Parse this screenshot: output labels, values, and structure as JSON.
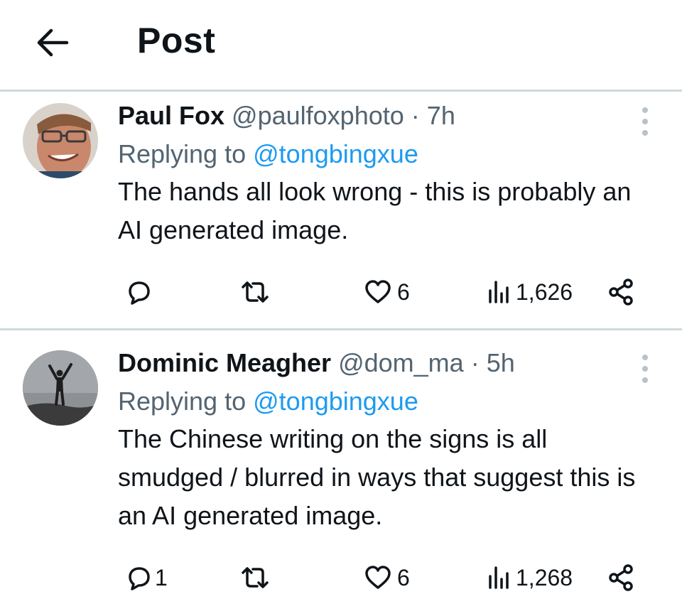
{
  "header": {
    "title": "Post",
    "back_icon": "arrow-left-icon"
  },
  "colors": {
    "link": "#1d9bf0",
    "secondary": "#536471",
    "primary": "#0f1419",
    "divider": "#cfd9de"
  },
  "replies": [
    {
      "name": "Paul Fox",
      "handle": "@paulfoxphoto",
      "separator": "·",
      "time": "7h",
      "replying_label": "Replying to",
      "replying_to": "@tongbingxue",
      "text": "The hands all look wrong - this is probably an AI generated image.",
      "reply_count": "",
      "likes": "6",
      "views": "1,626"
    },
    {
      "name": "Dominic Meagher",
      "handle": "@dom_ma",
      "separator": "·",
      "time": "5h",
      "replying_label": "Replying to",
      "replying_to": "@tongbingxue",
      "text": "The Chinese writing on the signs is all smudged / blurred in ways that suggest this is an AI generated image.",
      "reply_count": "1",
      "likes": "6",
      "views": "1,268"
    }
  ]
}
